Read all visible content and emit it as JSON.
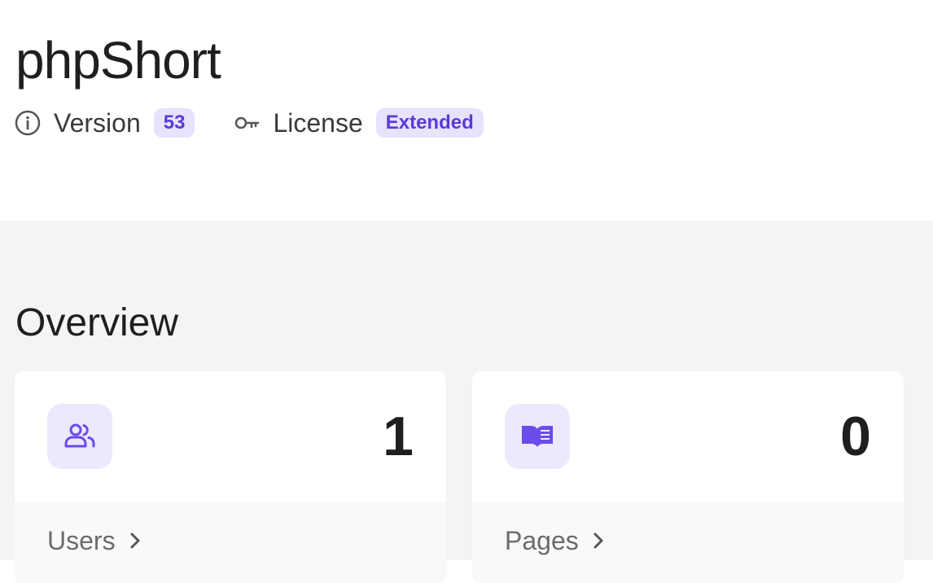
{
  "header": {
    "title": "phpShort",
    "version_label": "Version",
    "version_value": "53",
    "license_label": "License",
    "license_value": "Extended"
  },
  "overview": {
    "title": "Overview",
    "cards": [
      {
        "icon": "users-icon",
        "count": "1",
        "label": "Users"
      },
      {
        "icon": "book-open-icon",
        "count": "0",
        "label": "Pages"
      }
    ]
  },
  "colors": {
    "accent": "#5b3ad6",
    "badge_bg": "#e7e2fd",
    "icon_bg": "#ece8fd",
    "icon_fg": "#6a4ce8",
    "content_bg": "#f4f4f4"
  }
}
